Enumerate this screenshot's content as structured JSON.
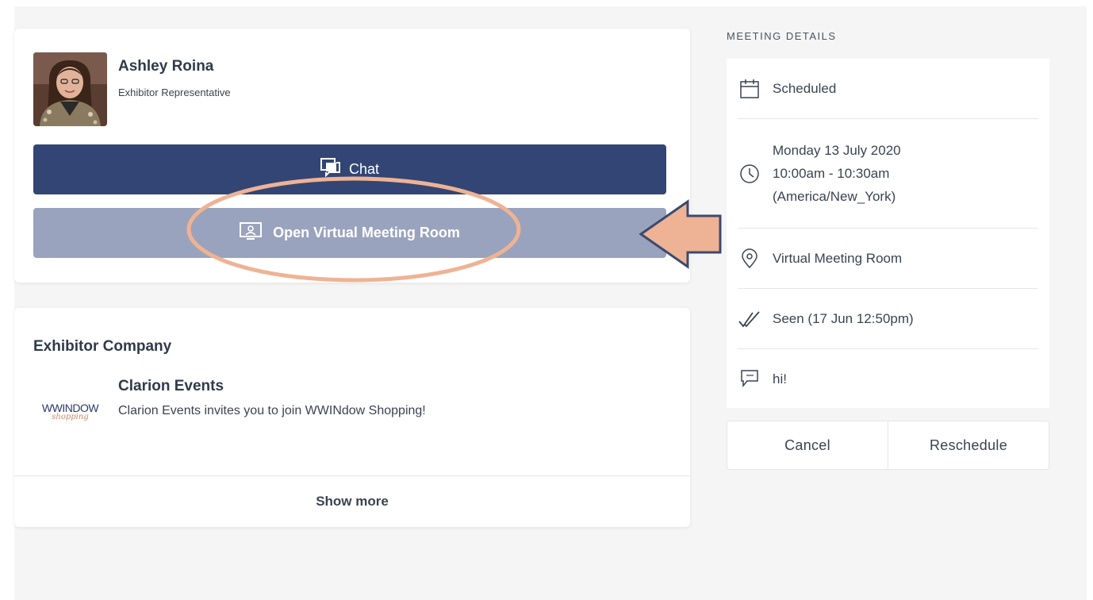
{
  "representative": {
    "name": "Ashley Roina",
    "role": "Exhibitor Representative",
    "chat_label": "Chat",
    "vmr_label": "Open Virtual Meeting Room"
  },
  "company": {
    "heading": "Exhibitor Company",
    "logo_text": "WWINDOW",
    "logo_subtext": "shopping",
    "name": "Clarion Events",
    "description": "Clarion Events invites you to join WWINdow Shopping!",
    "show_more_label": "Show more"
  },
  "meeting_details": {
    "title": "MEETING DETAILS",
    "status": "Scheduled",
    "date": "Monday 13 July 2020",
    "time": "10:00am - 10:30am",
    "timezone": "(America/New_York)",
    "location": "Virtual Meeting Room",
    "seen": "Seen (17 Jun 12:50pm)",
    "message": "hi!"
  },
  "actions": {
    "cancel_label": "Cancel",
    "reschedule_label": "Reschedule"
  },
  "icons": {
    "chat": "chat-icon",
    "vmr": "video-screen-icon",
    "status": "calendar-icon",
    "time": "clock-icon",
    "location": "location-pin-icon",
    "seen": "double-check-icon",
    "message": "speech-bubble-icon"
  },
  "colors": {
    "primary_button": "#334575",
    "secondary_button": "#9aa3bd",
    "annotation": "#eeb394",
    "annotation_stroke": "#3c4a6e"
  }
}
